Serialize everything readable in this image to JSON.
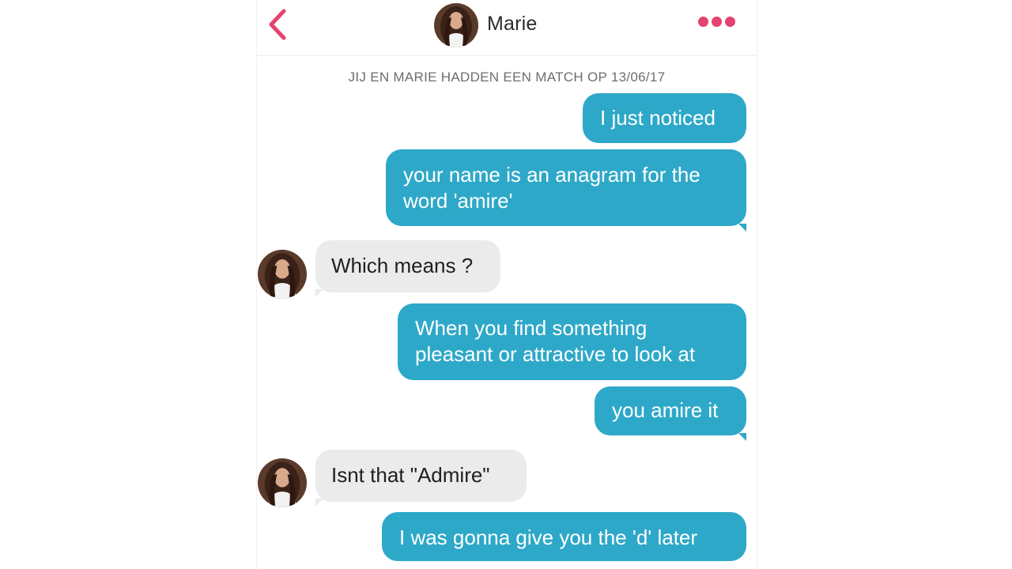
{
  "header": {
    "contact_name": "Marie",
    "back_icon": "chevron-left-icon",
    "more_icon": "more-dots-icon",
    "accent_color": "#e5436f"
  },
  "match_line": "JIJ EN MARIE HADDEN EEN MATCH OP 13/06/17",
  "messages": [
    {
      "from": "me",
      "text": "I just noticed"
    },
    {
      "from": "me",
      "text": "your name is an anagram for the word 'amire'"
    },
    {
      "from": "Marie",
      "text": "Which means ?"
    },
    {
      "from": "me",
      "text": "When you find something pleasant or attractive to look at"
    },
    {
      "from": "me",
      "text": "you amire it"
    },
    {
      "from": "Marie",
      "text": "Isnt that \"Admire\""
    },
    {
      "from": "me",
      "text": "I was gonna give you the 'd' later"
    }
  ],
  "colors": {
    "outgoing_bubble": "#2ea8c8",
    "incoming_bubble": "#ebebeb",
    "accent": "#e5436f"
  }
}
